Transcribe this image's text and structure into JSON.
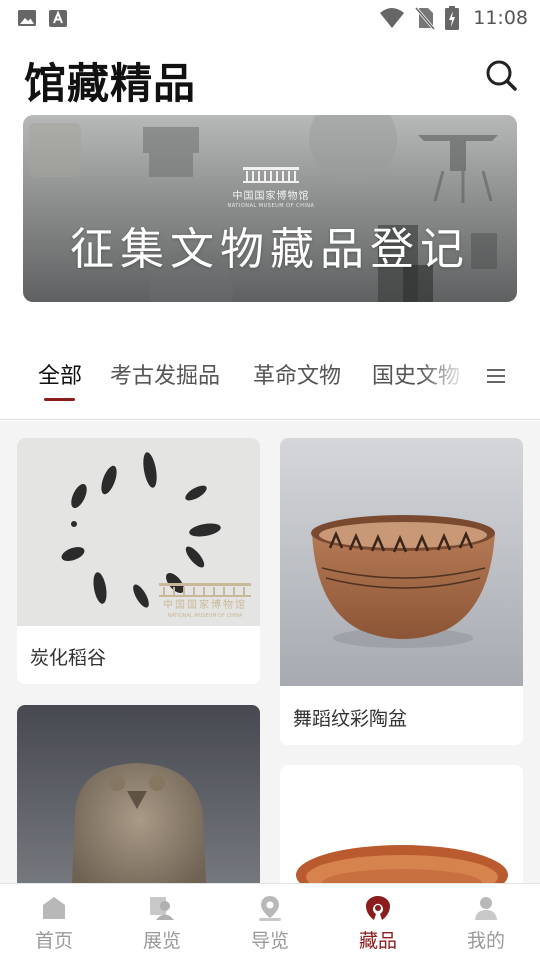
{
  "status_bar": {
    "time": "11:08",
    "left_icons": [
      "image-icon",
      "text-a-icon"
    ],
    "right_icons": [
      "wifi-icon",
      "no-sim-icon",
      "battery-charging-icon"
    ]
  },
  "header": {
    "title": "馆藏精品",
    "search_icon": "search-icon"
  },
  "banner": {
    "logo_text": "中国国家博物馆",
    "logo_subtext": "NATIONAL MUSEUM OF CHINA",
    "title": "征集文物藏品登记"
  },
  "tabs": {
    "items": [
      "全部",
      "考古发掘品",
      "革命文物",
      "国史文物"
    ],
    "active": "全部",
    "menu_icon": "menu-icon"
  },
  "collection": {
    "items": [
      {
        "label": "炭化稻谷",
        "watermark": "中国国家博物馆",
        "watermark_sub": "NATIONAL MUSEUM OF CHINA"
      },
      {
        "label": "舞蹈纹彩陶盆"
      },
      {
        "label": ""
      },
      {
        "label": ""
      }
    ]
  },
  "bottom_nav": {
    "items": [
      {
        "label": "首页",
        "icon": "home-icon"
      },
      {
        "label": "展览",
        "icon": "exhibition-icon"
      },
      {
        "label": "导览",
        "icon": "location-pin-icon"
      },
      {
        "label": "藏品",
        "icon": "collection-icon"
      },
      {
        "label": "我的",
        "icon": "profile-icon"
      }
    ],
    "active": "藏品"
  },
  "colors": {
    "accent": "#8b1d1d",
    "inactive_nav": "#9a9a9a",
    "content_bg": "#f4f4f4"
  }
}
